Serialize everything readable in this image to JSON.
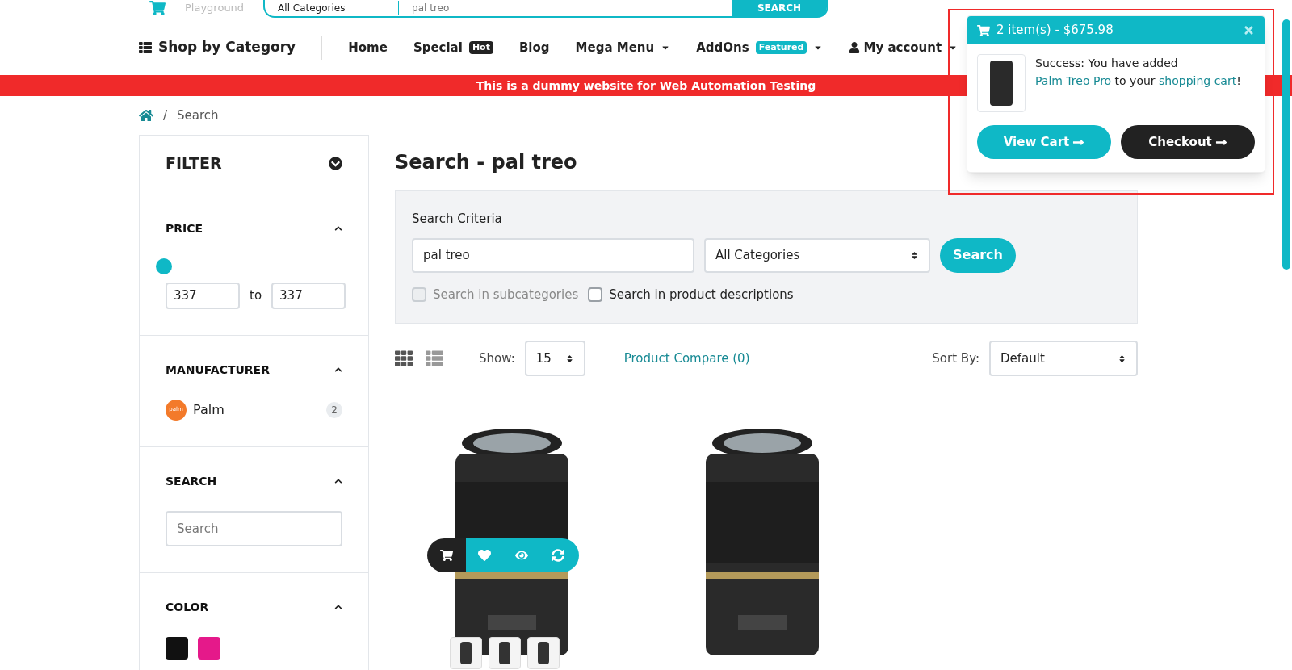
{
  "header": {
    "logo_text": "Playground",
    "category": "All Categories",
    "query": "pal treo",
    "search_button": "SEARCH"
  },
  "nav": {
    "category_menu": "Shop by Category",
    "items": [
      {
        "label": "Home",
        "dropdown": false,
        "icon": false
      },
      {
        "label": "Special",
        "badge": {
          "text": "Hot",
          "color": "#222222"
        },
        "dropdown": false,
        "icon": false
      },
      {
        "label": "Blog",
        "dropdown": false,
        "icon": false
      },
      {
        "label": "Mega Menu",
        "dropdown": true,
        "icon": false
      },
      {
        "label": "AddOns",
        "badge": {
          "text": "Featured",
          "color": "#0fb8c6"
        },
        "dropdown": true,
        "icon": false
      },
      {
        "label": "My account",
        "dropdown": true,
        "icon": true
      }
    ]
  },
  "banner": "This is a dummy website for Web Automation Testing",
  "breadcrumb": [
    {
      "separator": "/",
      "label": "Search"
    }
  ],
  "filter": {
    "title": "FILTER",
    "price": {
      "title": "PRICE",
      "min": "337",
      "to": "to",
      "max": "337"
    },
    "manufacturer": {
      "title": "MANUFACTURER",
      "items": [
        {
          "logo": "palm",
          "name": "Palm",
          "count": "2"
        }
      ]
    },
    "search": {
      "title": "SEARCH",
      "placeholder": "Search"
    },
    "color": {
      "title": "COLOR",
      "swatches": [
        {
          "color": "#111111"
        },
        {
          "color": "#e5198a"
        }
      ]
    }
  },
  "content": {
    "title": "Search - pal treo",
    "criteria": {
      "label": "Search Criteria",
      "query": "pal treo",
      "category": "All Categories",
      "button": "Search",
      "options": [
        {
          "label": "Search in subcategories",
          "checked": false,
          "disabled": true
        },
        {
          "label": "Search in product descriptions",
          "checked": false,
          "disabled": false
        }
      ]
    },
    "toolbar": {
      "views": [
        {
          "kind": "grid",
          "selected": true
        },
        {
          "kind": "list",
          "selected": false
        }
      ],
      "show_label": "Show:",
      "show_value": "15",
      "compare": "Product Compare (0)",
      "sort_label": "Sort By:",
      "sort_value": "Default"
    },
    "products": [
      {
        "hovered": true
      },
      {
        "hovered": false
      }
    ]
  },
  "cart_popup": {
    "summary": "2 item(s) - $675.98",
    "message": [
      {
        "kind": "text",
        "text": "Success: You have added "
      },
      {
        "kind": "link",
        "text": "Palm Treo Pro"
      },
      {
        "kind": "text",
        "text": " to your "
      },
      {
        "kind": "link",
        "text": "shopping cart"
      },
      {
        "kind": "text",
        "text": "!"
      }
    ],
    "view_cart": "View Cart",
    "checkout": "Checkout"
  }
}
